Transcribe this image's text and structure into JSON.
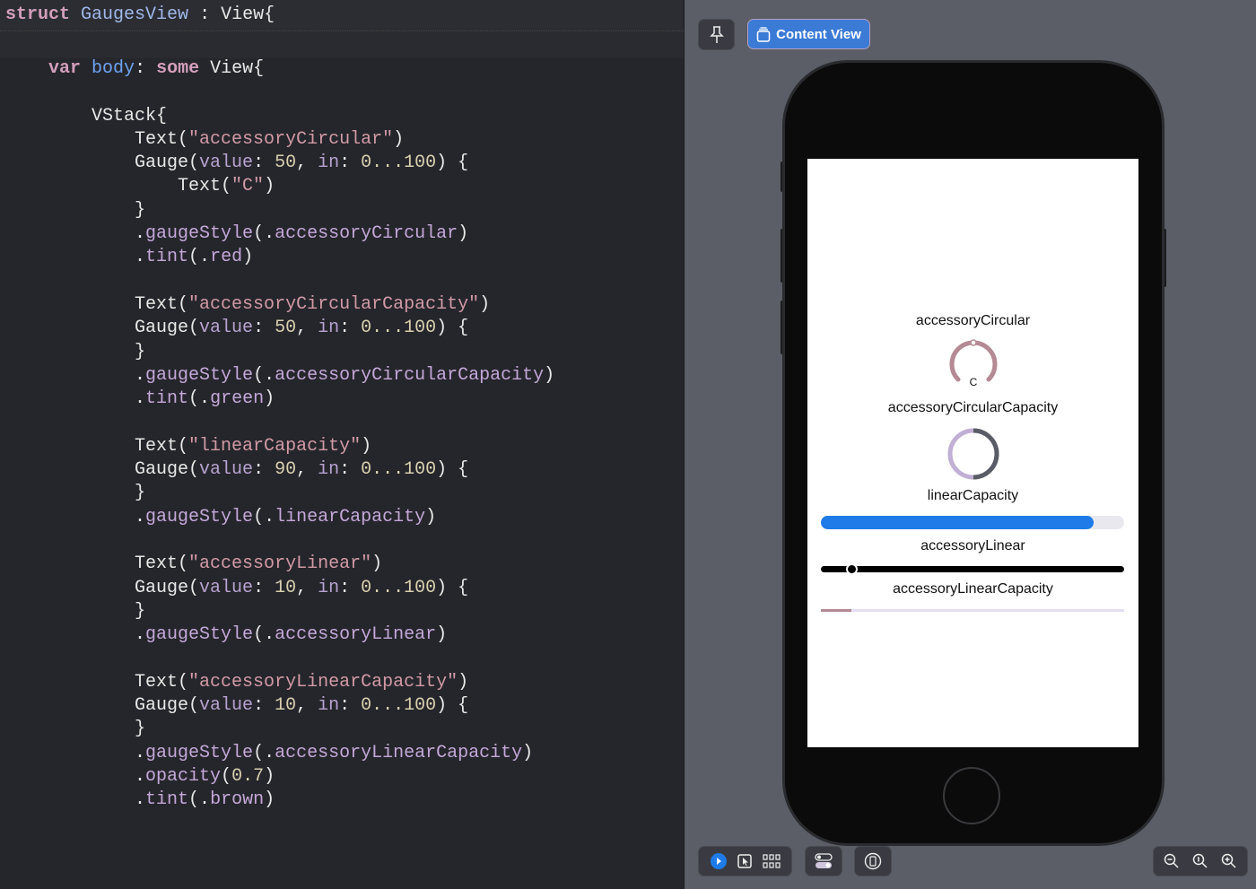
{
  "editor": {
    "sticky_line": [
      [
        "struct",
        "kw"
      ],
      [
        " ",
        "plain"
      ],
      [
        "GaugesView",
        "type"
      ],
      [
        " : View{",
        "plain"
      ]
    ],
    "lines": [
      [
        [
          "    ",
          "plain"
        ],
        [
          "var",
          "kw"
        ],
        [
          " ",
          "plain"
        ],
        [
          "body",
          "decl"
        ],
        [
          ": ",
          "plain"
        ],
        [
          "some",
          "kw"
        ],
        [
          " View{",
          "plain"
        ]
      ],
      [],
      [
        [
          "        VStack{",
          "plain"
        ]
      ],
      [
        [
          "            Text(",
          "plain"
        ],
        [
          "\"accessoryCircular\"",
          "str"
        ],
        [
          ")",
          "plain"
        ]
      ],
      [
        [
          "            Gauge(",
          "plain"
        ],
        [
          "value",
          "param"
        ],
        [
          ": ",
          "plain"
        ],
        [
          "50",
          "num"
        ],
        [
          ", ",
          "plain"
        ],
        [
          "in",
          "param"
        ],
        [
          ": ",
          "plain"
        ],
        [
          "0...100",
          "num"
        ],
        [
          ") {",
          "plain"
        ]
      ],
      [
        [
          "                Text(",
          "plain"
        ],
        [
          "\"C\"",
          "str"
        ],
        [
          ")",
          "plain"
        ]
      ],
      [
        [
          "            }",
          "plain"
        ]
      ],
      [
        [
          "            .",
          "plain"
        ],
        [
          "gaugeStyle",
          "mod"
        ],
        [
          "(.",
          "plain"
        ],
        [
          "accessoryCircular",
          "mod"
        ],
        [
          ")",
          "plain"
        ]
      ],
      [
        [
          "            .",
          "plain"
        ],
        [
          "tint",
          "mod"
        ],
        [
          "(.",
          "plain"
        ],
        [
          "red",
          "mod"
        ],
        [
          ")",
          "plain"
        ]
      ],
      [],
      [
        [
          "            Text(",
          "plain"
        ],
        [
          "\"accessoryCircularCapacity\"",
          "str"
        ],
        [
          ")",
          "plain"
        ]
      ],
      [
        [
          "            Gauge(",
          "plain"
        ],
        [
          "value",
          "param"
        ],
        [
          ": ",
          "plain"
        ],
        [
          "50",
          "num"
        ],
        [
          ", ",
          "plain"
        ],
        [
          "in",
          "param"
        ],
        [
          ": ",
          "plain"
        ],
        [
          "0...100",
          "num"
        ],
        [
          ") {",
          "plain"
        ]
      ],
      [
        [
          "            }",
          "plain"
        ]
      ],
      [
        [
          "            .",
          "plain"
        ],
        [
          "gaugeStyle",
          "mod"
        ],
        [
          "(.",
          "plain"
        ],
        [
          "accessoryCircularCapacity",
          "mod"
        ],
        [
          ")",
          "plain"
        ]
      ],
      [
        [
          "            .",
          "plain"
        ],
        [
          "tint",
          "mod"
        ],
        [
          "(.",
          "plain"
        ],
        [
          "green",
          "mod"
        ],
        [
          ")",
          "plain"
        ]
      ],
      [],
      [
        [
          "            Text(",
          "plain"
        ],
        [
          "\"linearCapacity\"",
          "str"
        ],
        [
          ")",
          "plain"
        ]
      ],
      [
        [
          "            Gauge(",
          "plain"
        ],
        [
          "value",
          "param"
        ],
        [
          ": ",
          "plain"
        ],
        [
          "90",
          "num"
        ],
        [
          ", ",
          "plain"
        ],
        [
          "in",
          "param"
        ],
        [
          ": ",
          "plain"
        ],
        [
          "0...100",
          "num"
        ],
        [
          ") {",
          "plain"
        ]
      ],
      [
        [
          "            }",
          "plain"
        ]
      ],
      [
        [
          "            .",
          "plain"
        ],
        [
          "gaugeStyle",
          "mod"
        ],
        [
          "(.",
          "plain"
        ],
        [
          "linearCapacity",
          "mod"
        ],
        [
          ")",
          "plain"
        ]
      ],
      [],
      [
        [
          "            Text(",
          "plain"
        ],
        [
          "\"accessoryLinear\"",
          "str"
        ],
        [
          ")",
          "plain"
        ]
      ],
      [
        [
          "            Gauge(",
          "plain"
        ],
        [
          "value",
          "param"
        ],
        [
          ": ",
          "plain"
        ],
        [
          "10",
          "num"
        ],
        [
          ", ",
          "plain"
        ],
        [
          "in",
          "param"
        ],
        [
          ": ",
          "plain"
        ],
        [
          "0...100",
          "num"
        ],
        [
          ") {",
          "plain"
        ]
      ],
      [
        [
          "            }",
          "plain"
        ]
      ],
      [
        [
          "            .",
          "plain"
        ],
        [
          "gaugeStyle",
          "mod"
        ],
        [
          "(.",
          "plain"
        ],
        [
          "accessoryLinear",
          "mod"
        ],
        [
          ")",
          "plain"
        ]
      ],
      [],
      [
        [
          "            Text(",
          "plain"
        ],
        [
          "\"accessoryLinearCapacity\"",
          "str"
        ],
        [
          ")",
          "plain"
        ]
      ],
      [
        [
          "            Gauge(",
          "plain"
        ],
        [
          "value",
          "param"
        ],
        [
          ": ",
          "plain"
        ],
        [
          "10",
          "num"
        ],
        [
          ", ",
          "plain"
        ],
        [
          "in",
          "param"
        ],
        [
          ": ",
          "plain"
        ],
        [
          "0...100",
          "num"
        ],
        [
          ") {",
          "plain"
        ]
      ],
      [
        [
          "            }",
          "plain"
        ]
      ],
      [
        [
          "            .",
          "plain"
        ],
        [
          "gaugeStyle",
          "mod"
        ],
        [
          "(.",
          "plain"
        ],
        [
          "accessoryLinearCapacity",
          "mod"
        ],
        [
          ")",
          "plain"
        ]
      ],
      [
        [
          "            .",
          "plain"
        ],
        [
          "opacity",
          "mod"
        ],
        [
          "(",
          "plain"
        ],
        [
          "0.7",
          "num"
        ],
        [
          ")",
          "plain"
        ]
      ],
      [
        [
          "            .",
          "plain"
        ],
        [
          "tint",
          "mod"
        ],
        [
          "(.",
          "plain"
        ],
        [
          "brown",
          "mod"
        ],
        [
          ")",
          "plain"
        ]
      ]
    ]
  },
  "preview": {
    "toolbar": {
      "content_view_label": "Content View",
      "pin_icon": "pin-icon"
    },
    "gauges": {
      "accessory_circular": {
        "label": "accessoryCircular",
        "current_label": "C",
        "value": 50,
        "min": 0,
        "max": 100,
        "color": "#b48a94"
      },
      "accessory_circular_capacity": {
        "label": "accessoryCircularCapacity",
        "value": 50,
        "min": 0,
        "max": 100,
        "fill_color": "#5a5d66",
        "track_color": "#c0b0d4"
      },
      "linear_capacity": {
        "label": "linearCapacity",
        "value": 90,
        "min": 0,
        "max": 100,
        "fill_color": "#1e7be8"
      },
      "accessory_linear": {
        "label": "accessoryLinear",
        "value": 10,
        "min": 0,
        "max": 100,
        "color": "#000000"
      },
      "accessory_linear_capacity": {
        "label": "accessoryLinearCapacity",
        "value": 10,
        "min": 0,
        "max": 100,
        "fill_color": "#b48a94"
      }
    },
    "bottom_toolbar": [
      "live-preview-icon",
      "selectable-icon",
      "variants-grid-icon",
      "device-settings-icon",
      "device-icon",
      "zoom-out-icon",
      "zoom-actual-icon",
      "zoom-in-icon"
    ]
  }
}
